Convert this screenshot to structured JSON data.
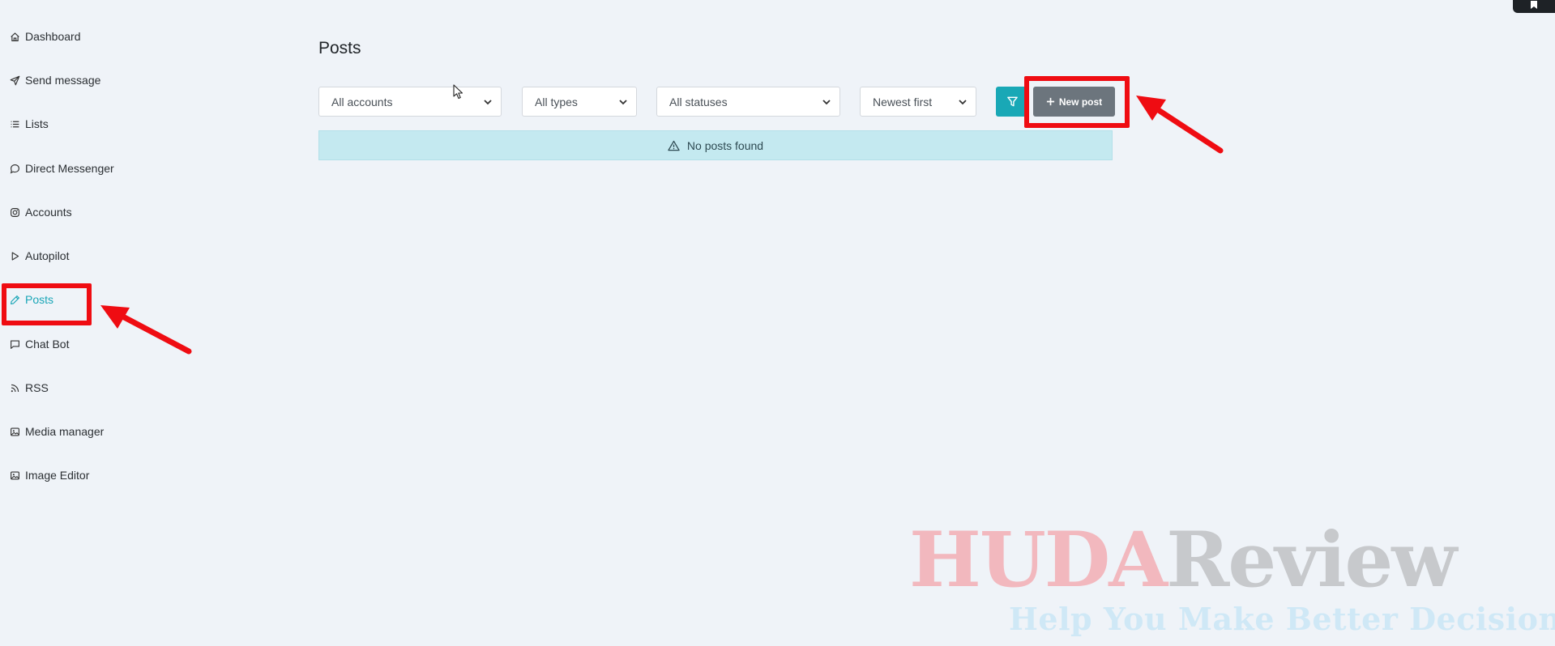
{
  "sidebar": {
    "items": [
      {
        "label": "Dashboard",
        "icon": "home-icon"
      },
      {
        "label": "Send message",
        "icon": "send-icon"
      },
      {
        "label": "Lists",
        "icon": "list-icon"
      },
      {
        "label": "Direct Messenger",
        "icon": "chat-bubble-icon"
      },
      {
        "label": "Accounts",
        "icon": "instagram-icon"
      },
      {
        "label": "Autopilot",
        "icon": "play-icon"
      },
      {
        "label": "Posts",
        "icon": "pencil-icon",
        "active": true
      },
      {
        "label": "Chat Bot",
        "icon": "message-square-icon"
      },
      {
        "label": "RSS",
        "icon": "rss-icon"
      },
      {
        "label": "Media manager",
        "icon": "image-icon"
      },
      {
        "label": "Image Editor",
        "icon": "image-icon"
      }
    ]
  },
  "main": {
    "title": "Posts",
    "filters": {
      "account": "All accounts",
      "type": "All types",
      "status": "All statuses",
      "sort": "Newest first"
    },
    "new_post_label": "New post",
    "empty_message": "No posts found"
  },
  "watermark": {
    "brand_part1": "HUDA",
    "brand_part2": "Review",
    "tagline": "Help You Make Better Decisions"
  },
  "colors": {
    "accent": "#1aa6b7",
    "filter_button": "#19a8b6",
    "new_post_button": "#6c757d",
    "alert_bg": "#c4e9f0",
    "annotation_red": "#ef0c12"
  }
}
